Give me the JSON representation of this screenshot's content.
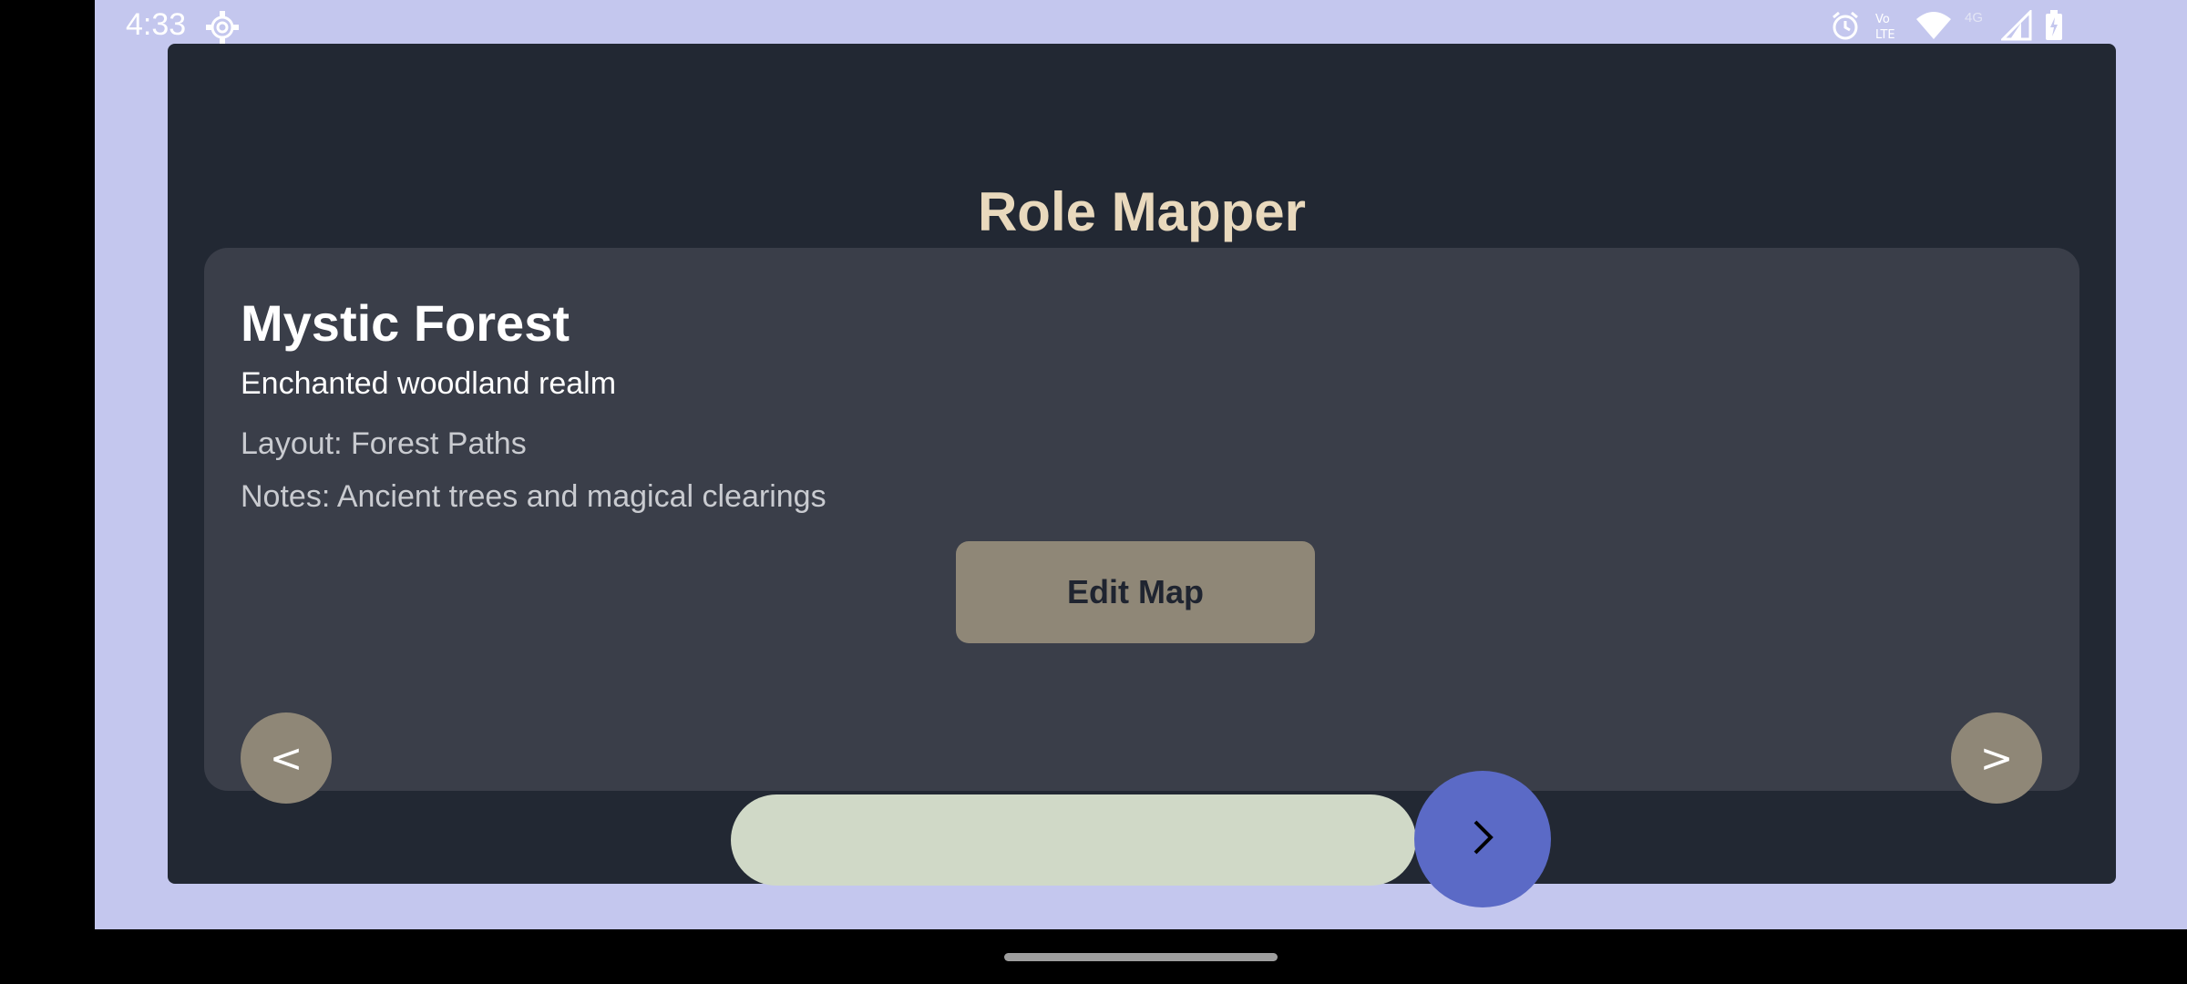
{
  "status_bar": {
    "time": "4:33",
    "icons": [
      "settings-gear-icon",
      "alarm-icon",
      "volte-icon",
      "wifi-icon",
      "4g-icon",
      "signal-icon",
      "battery-icon"
    ],
    "network_label": "4G"
  },
  "app": {
    "title": "Role Mapper"
  },
  "map_card": {
    "name": "Mystic Forest",
    "description": "Enchanted woodland realm",
    "layout": "Layout: Forest Paths",
    "notes": "Notes: Ancient trees and magical clearings",
    "edit_button_label": "Edit Map",
    "prev_label": "<",
    "next_label": ">"
  },
  "colors": {
    "screen_bg": "#c4c7ee",
    "card_bg": "#222833",
    "panel_bg": "#3a3e49",
    "title_color": "#e9d9bd",
    "button_bg": "#8f8777",
    "pill_bg": "#d0d9c7",
    "fab_bg": "#5b6ac6"
  }
}
